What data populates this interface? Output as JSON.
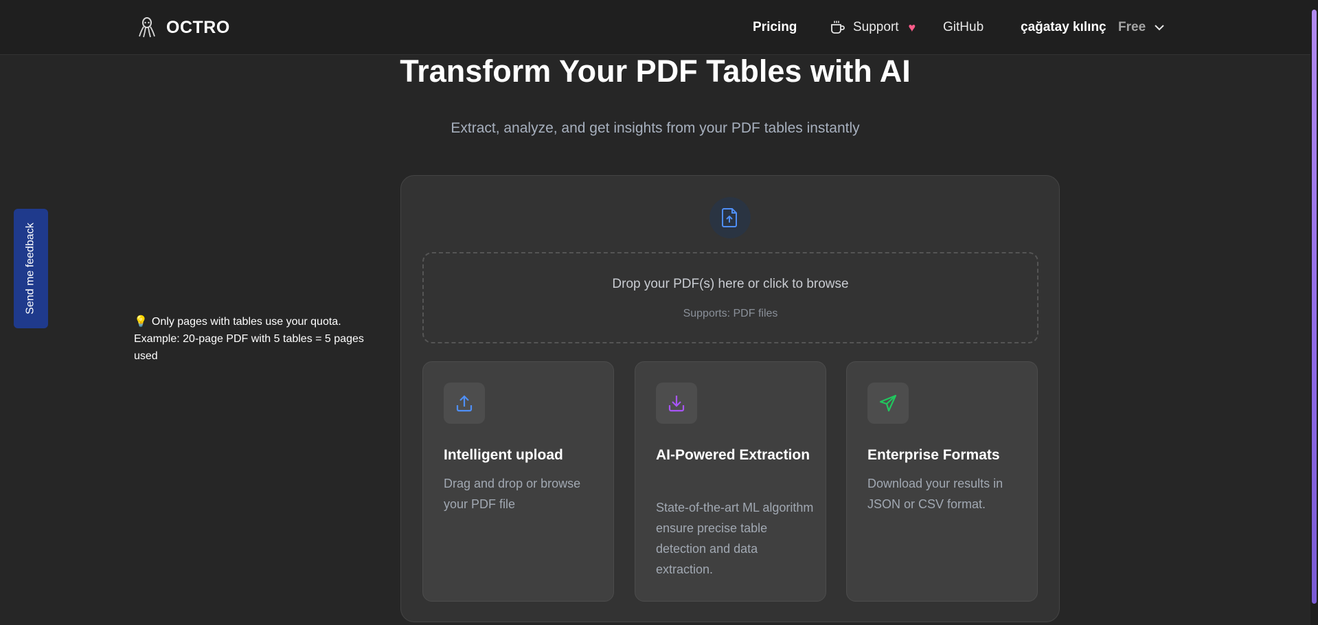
{
  "header": {
    "brand": "OCTRO",
    "nav": {
      "pricing": "Pricing",
      "support": "Support",
      "github": "GitHub",
      "user": "çağatay kılınç",
      "plan": "Free"
    }
  },
  "hero": {
    "title": "Transform Your PDF Tables with AI",
    "subtitle": "Extract, analyze, and get insights from your PDF tables instantly"
  },
  "feedback": {
    "label": "Send me feedback"
  },
  "quota_note": {
    "text": "Only pages with tables use your quota. Example: 20-page PDF with 5 tables = 5 pages used"
  },
  "upload": {
    "title": "Drop your PDF(s) here or click to browse",
    "hint": "Supports: PDF files"
  },
  "features": [
    {
      "title": "Intelligent upload",
      "description": "Drag and drop or browse your PDF file",
      "icon": "upload-icon",
      "color": "#4f8ff7"
    },
    {
      "title": "AI-Powered Extraction",
      "description": "State-of-the-art ML algorithm ensure precise table detection and data extraction.",
      "icon": "download-icon",
      "color": "#a855f7"
    },
    {
      "title": "Enterprise Formats",
      "description": "Download your results in JSON or CSV format.",
      "icon": "send-icon",
      "color": "#22c55e"
    }
  ],
  "colors": {
    "background": "#262626",
    "header": "#1f1f1f",
    "card": "#333333",
    "feedback_tab": "#1f3a8c",
    "accent_blue": "#4f8ff7"
  }
}
